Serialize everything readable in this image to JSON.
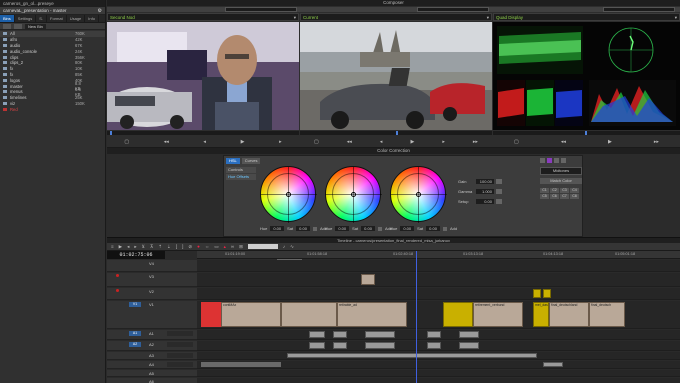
{
  "bin": {
    "title": "carneros_gn_ol...preseye",
    "subtitle": "carnevaL_presentation - master",
    "tabs": [
      "Bins",
      "Settings",
      "S.",
      "Format",
      "Usage",
      "Info"
    ],
    "filter_label": "New Bin",
    "items": [
      {
        "name": "All",
        "size": "760K"
      },
      {
        "name": "afro",
        "size": "42K"
      },
      {
        "name": "audio",
        "size": "67K"
      },
      {
        "name": "audio_console",
        "size": "24K"
      },
      {
        "name": "clips",
        "size": "356K"
      },
      {
        "name": "clips_2",
        "size": "80K"
      },
      {
        "name": "fx",
        "size": "10K"
      },
      {
        "name": "fx",
        "size": "85K"
      },
      {
        "name": "logos",
        "size": "40K"
      },
      {
        "name": "master",
        "size": "8.8 KB"
      },
      {
        "name": "menus",
        "size": "6.6 KB"
      },
      {
        "name": "timelines",
        "size": "25K"
      },
      {
        "name": "viz",
        "size": "150K"
      },
      {
        "name": "Red",
        "size": ""
      }
    ]
  },
  "composer": {
    "title": "Composer",
    "monitors": [
      {
        "label": "Second Nod"
      },
      {
        "label": "Current"
      },
      {
        "label": "Quad Display"
      }
    ],
    "transport_glyphs": [
      "▢",
      "◂◂",
      "◂",
      "▶",
      "▸",
      "▸▸",
      "⇤",
      "⇥"
    ]
  },
  "color_correction": {
    "title": "Color Correction",
    "tabs": [
      "HSL",
      "Curves"
    ],
    "side_items": [
      "Controls",
      "Hue Offsets"
    ],
    "wheels": [
      {
        "label": "Hue",
        "value": "0.00",
        "sat_label": "Sat",
        "sat": "0.00",
        "chk": "Add"
      },
      {
        "label": "Hue",
        "value": "0.00",
        "sat_label": "Sat",
        "sat": "0.00",
        "chk": "Add"
      },
      {
        "label": "Hue",
        "value": "0.00",
        "sat_label": "Sat",
        "sat": "0.00",
        "chk": "Add"
      }
    ],
    "params": [
      {
        "label": "Gain",
        "value": "100.00"
      },
      {
        "label": "Gamma",
        "value": "1.000"
      },
      {
        "label": "Setup",
        "value": "0.00"
      }
    ],
    "mode_select": "Midtones",
    "match_button": "Match Color",
    "grid_labels": [
      "C1",
      "C2",
      "C3",
      "C4",
      "C5",
      "C6",
      "C7",
      "C8"
    ]
  },
  "timeline": {
    "title": "Timeline - carneros/presentation_final_rendered_misa_jurkanov",
    "timecode": "01:02:75:06",
    "tooltip": "Fast Menu",
    "ruler_labels": [
      "01:01:19:00",
      "01:01:58:18",
      "01:02:40:18",
      "01:03:13:18",
      "01:04:13:18",
      "01:05:01:18",
      "01:06:11:18"
    ],
    "tracks": [
      {
        "name": "V4"
      },
      {
        "name": "V3"
      },
      {
        "name": "V2"
      },
      {
        "name": "V1"
      },
      {
        "name": "A1"
      },
      {
        "name": "A2"
      },
      {
        "name": "A3"
      },
      {
        "name": "A4"
      },
      {
        "name": "A5"
      },
      {
        "name": "A6"
      }
    ],
    "clip_labels": {
      "c1": "contMAx",
      "c2": "retirable_ad",
      "c3": "mel_dash",
      "c4": "retirement_verbund",
      "c5": "final_deutschland",
      "c6": "final_deutsch"
    }
  }
}
